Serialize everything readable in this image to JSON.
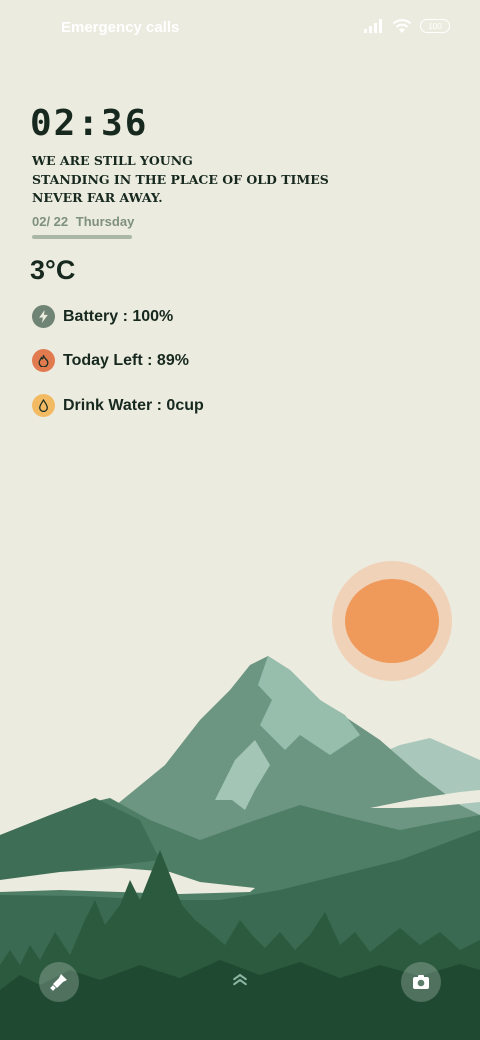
{
  "status_bar": {
    "carrier_text": "Emergency calls",
    "battery_level": "100",
    "icons": [
      "signal-icon",
      "wifi-icon",
      "battery-icon"
    ]
  },
  "lockscreen": {
    "time": "02:36",
    "quote_lines": [
      "WE ARE STILL YOUNG",
      "STANDING IN THE PLACE OF OLD TIMES",
      "NEVER FAR AWAY."
    ],
    "date": "02/ 22",
    "weekday": "Thursday",
    "temperature": "3°C"
  },
  "info_items": [
    {
      "label": "Battery : 100%",
      "icon": "lightning-icon",
      "color": "#6f8474"
    },
    {
      "label": "Today Left : 89%",
      "icon": "flame-icon",
      "color": "#e17b4f"
    },
    {
      "label": "Drink Water : 0cup",
      "icon": "water-drop-icon",
      "color": "#f2bb63"
    }
  ],
  "bottom_bar": {
    "left_icon": "flashlight-icon",
    "center_icon": "swipe-up-icon",
    "right_icon": "camera-icon"
  },
  "colors": {
    "background": "#ecebdf",
    "sun": "#ef9a5a",
    "sun_halo": "#efd2b8",
    "mountain_light": "#8fb5a4",
    "forest_dark": "#2c5a3e",
    "text_dark": "#17291f"
  }
}
